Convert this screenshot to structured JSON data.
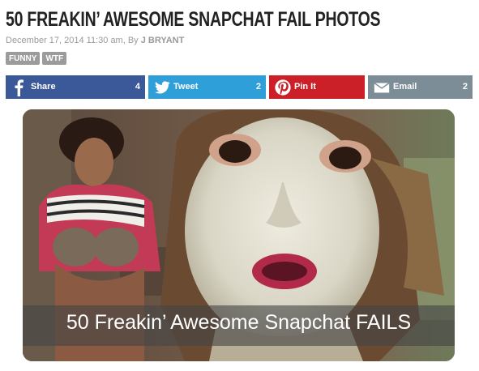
{
  "article": {
    "title": "50 FREAKIN’ AWESOME SNAPCHAT FAIL PHOTOS",
    "meta_prefix": "December 17, 2014 11:30 am, By ",
    "author": "J BRYANT",
    "tags": [
      "FUNNY",
      "WTF"
    ]
  },
  "share": {
    "facebook": {
      "label": "Share",
      "count": "4",
      "icon": "facebook-icon",
      "color": "#3b5998"
    },
    "twitter": {
      "label": "Tweet",
      "count": "2",
      "icon": "twitter-bird-icon",
      "color": "#2f9fd9"
    },
    "pinterest": {
      "label": "Pin It",
      "count": "",
      "icon": "pinterest-icon",
      "color": "#cb2027"
    },
    "email": {
      "label": "Email",
      "count": "2",
      "icon": "envelope-icon",
      "color": "#7d8d97"
    }
  },
  "photo": {
    "caption": "50 Freakin’ Awesome Snapchat FAILS"
  }
}
